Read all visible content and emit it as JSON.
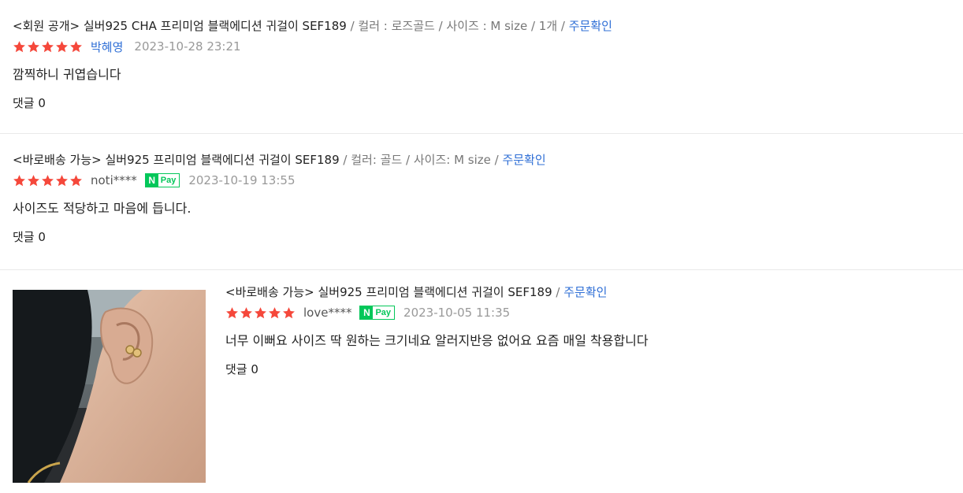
{
  "reviews": [
    {
      "product": "<회원 공개> 실버925 CHA 프리미엄 블랙에디션 귀걸이 SEF189",
      "options": " / 컬러 : 로즈골드 / 사이즈 : M size / 1개 / ",
      "order_link": "주문확인",
      "rating": 5,
      "author": "박혜영",
      "npay": false,
      "date": "2023-10-28 23:21",
      "text": "깜찍하니 귀엽습니다",
      "comments": "댓글 0"
    },
    {
      "product": "<바로배송 가능> 실버925 프리미엄 블랙에디션 귀걸이 SEF189",
      "options": " / 컬러: 골드 / 사이즈: M size / ",
      "order_link": "주문확인",
      "rating": 5,
      "author": "noti****",
      "npay": true,
      "npay_n": "N",
      "npay_pay": "Pay",
      "date": "2023-10-19 13:55",
      "text": "사이즈도 적당하고 마음에 듭니다.",
      "comments": "댓글 0"
    },
    {
      "product": "<바로배송 가능> 실버925 프리미엄 블랙에디션 귀걸이 SEF189",
      "options": " / ",
      "order_link": "주문확인",
      "rating": 5,
      "author": "love****",
      "npay": true,
      "npay_n": "N",
      "npay_pay": "Pay",
      "date": "2023-10-05 11:35",
      "text": "너무 이뻐요 사이즈 딱 원하는 크기네요 알러지반응 없어요 요즘 매일 착용합니다",
      "comments": "댓글 0",
      "photo_icon": "review-photo-icon"
    }
  ],
  "colors": {
    "star": "#f5483b",
    "link": "#2f6fd6",
    "npay": "#03c75a",
    "muted": "#999999",
    "divider": "#e9e9e9"
  },
  "icons": {
    "star": "star-icon",
    "npay": "npay-badge-icon"
  }
}
